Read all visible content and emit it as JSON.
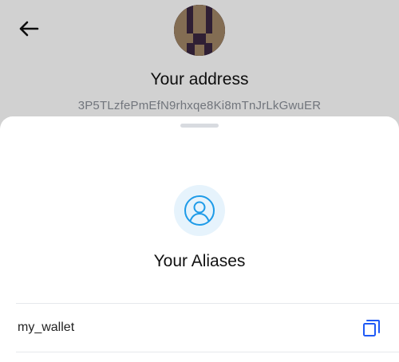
{
  "header": {
    "back_icon": "arrow-left-icon",
    "avatar_icon": "address-avatar-identicon",
    "title": "Your address",
    "address": "3P5TLzfePmEfN9rhxqe8Ki8mTnJrLkGwuER"
  },
  "sheet": {
    "icon": "user-circle-icon",
    "title": "Your Aliases",
    "aliases": [
      {
        "name": "my_wallet",
        "action_icon": "copy-icon"
      }
    ]
  },
  "colors": {
    "accent": "#1f5af6",
    "icon_blue": "#1e9be8",
    "icon_bg": "#e6f3fc",
    "muted_text": "#8a8f98",
    "overlay": "rgba(0,0,0,0.18)"
  }
}
